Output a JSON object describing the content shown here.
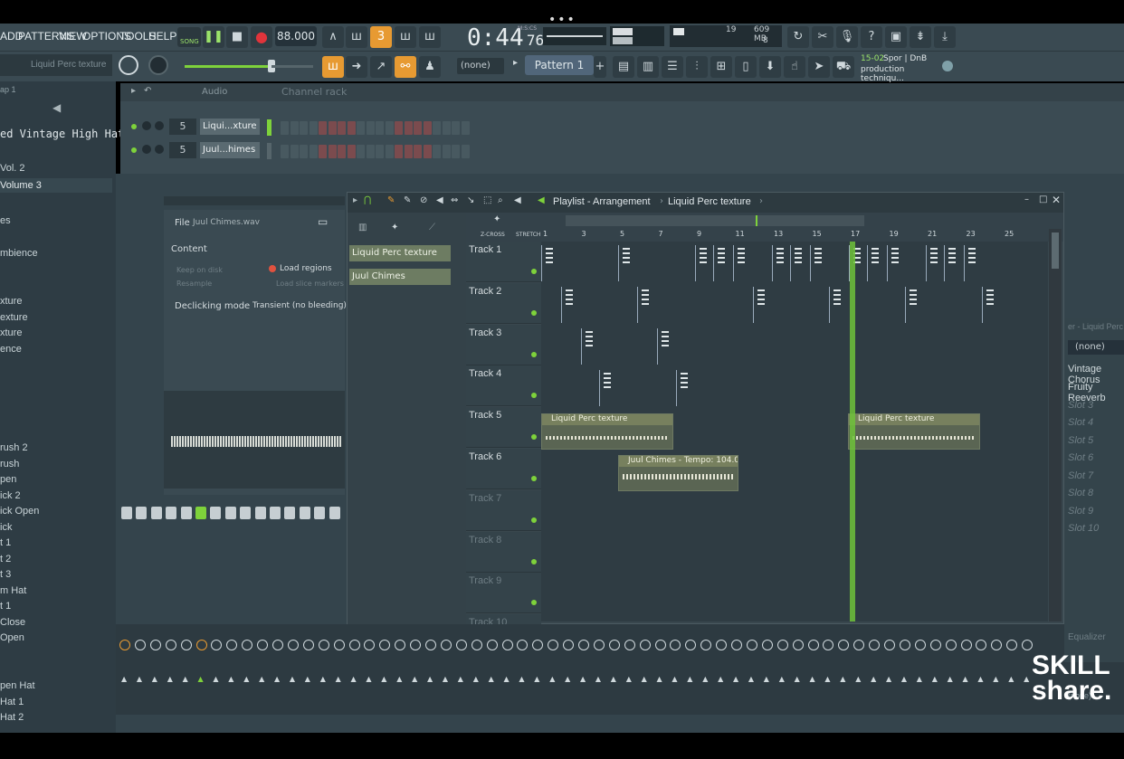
{
  "topbar": {
    "dots": "•••"
  },
  "menu": {
    "items": [
      "ADD",
      "PATTERNS",
      "VIEW",
      "OPTIONS",
      "TOOLS",
      "HELP"
    ],
    "mode": "SONG",
    "tempo": "88.000",
    "time_main": "0:44",
    "time_sub": "76",
    "time_unit": "M:S:CS",
    "cpu": "19",
    "mem": "609 MB",
    "poly": "8"
  },
  "toolbar": {
    "hint": "Liquid Perc texture",
    "none_select": "(none)",
    "pattern": "Pattern 1",
    "news_date": "15-02",
    "news_line1": "Spor | DnB",
    "news_line2": "production techniqu..."
  },
  "browser": {
    "items": [
      "ap 1",
      "ed Vintage High Hat",
      "Vol. 2",
      "Volume 3",
      "es",
      "mbience",
      "xture",
      "exture",
      "xture",
      "ence",
      "rush 2",
      "rush",
      "pen",
      "ick 2",
      "ick Open",
      "ick",
      "t 1",
      "t 2",
      "t 3",
      "m Hat",
      "t 1",
      "Close",
      "Open",
      "pen Hat",
      "Hat 1",
      "Hat 2"
    ]
  },
  "channel_rack": {
    "audio_label": "Audio",
    "title": "Channel rack",
    "channels": [
      {
        "num": "5",
        "name": "Liqui...xture"
      },
      {
        "num": "5",
        "name": "Juul...himes"
      }
    ],
    "add": "+"
  },
  "sampler": {
    "file_label": "File",
    "file_name": "Juul Chimes.wav",
    "content_label": "Content",
    "keep_on_disk": "Keep on disk",
    "load_regions": "Load regions",
    "resample": "Resample",
    "load_slice": "Load slice markers",
    "declick_label": "Declicking mode",
    "declick_value": "Transient (no bleeding)"
  },
  "playlist": {
    "title": "Playlist - Arrangement",
    "pattern": "Liquid Perc texture",
    "zcross": "Z-CROSS",
    "stretch": "STRETCH",
    "picker": [
      "Liquid Perc texture",
      "Juul Chimes"
    ],
    "ruler": [
      "1",
      "3",
      "5",
      "7",
      "9",
      "11",
      "13",
      "15",
      "17",
      "19",
      "21",
      "23",
      "25"
    ],
    "tracks": [
      "Track 1",
      "Track 2",
      "Track 3",
      "Track 4",
      "Track 5",
      "Track 6",
      "Track 7",
      "Track 8",
      "Track 9",
      "Track 10"
    ],
    "clip_liquid": "Liquid Perc texture",
    "clip_chimes": "Juul Chimes - Tempo: 104.0"
  },
  "fx": {
    "header": "er - Liquid Perc",
    "none": "(none)",
    "slots": [
      "Vintage Chorus",
      "Fruity Reeverb",
      "Slot 3",
      "Slot 4",
      "Slot 5",
      "Slot 6",
      "Slot 7",
      "Slot 8",
      "Slot 9",
      "Slot 10"
    ],
    "equalizer": "Equalizer",
    "none_bottom": "(none)"
  },
  "watermark": {
    "line1": "SKILL",
    "line2": "share."
  },
  "colors": {
    "accent": "#e79a32",
    "green": "#7ed23b",
    "panel": "#3a4a52"
  }
}
